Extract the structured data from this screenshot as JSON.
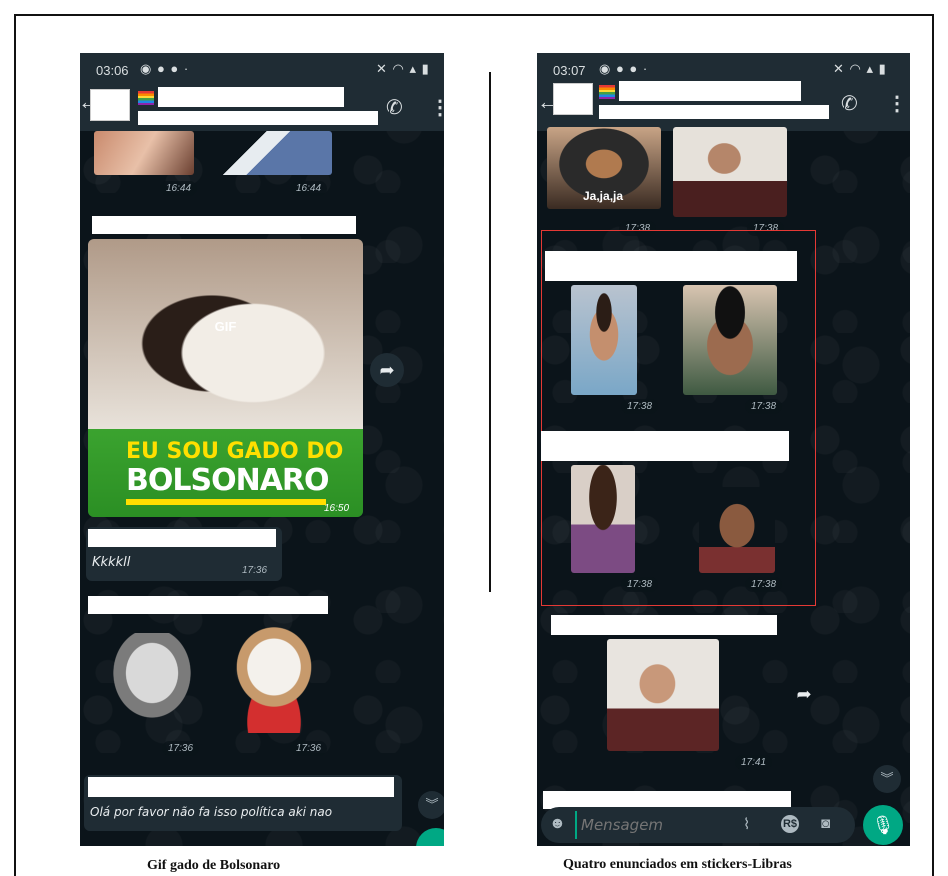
{
  "left_phone": {
    "status_time": "03:06",
    "timestamps_top": [
      "16:44",
      "16:44"
    ],
    "gif_label": "GIF",
    "banner_line1": "EU SOU GADO DO",
    "banner_line2": "BOLSONARO",
    "gif_time": "16:50",
    "message_1": "Kkkkll",
    "message_1_time": "17:36",
    "sticker_times": [
      "17:36",
      "17:36"
    ],
    "message_2": "Olá por favor não fa isso política aki nao"
  },
  "right_phone": {
    "status_time": "03:07",
    "top_sticker_caption": "Ja,ja,ja",
    "top_times": [
      "17:38",
      "17:38"
    ],
    "libras_times": [
      "17:38",
      "17:38",
      "17:38",
      "17:38"
    ],
    "last_time": "17:41",
    "input_placeholder": "Mensagem"
  },
  "captions": {
    "left": "Gif gado de Bolsonaro",
    "right": "Quatro enunciados em stickers-Libras"
  },
  "icons": {
    "back": "back-arrow-icon",
    "call": "add-call-icon",
    "menu": "menu-icon",
    "forward": "forward-icon",
    "emoji": "emoji-icon",
    "attach": "paperclip-icon",
    "payment": "rs-payment-icon",
    "camera": "camera-icon",
    "mic": "microphone-icon"
  },
  "colors": {
    "chat_bg": "#0b141a",
    "bar_bg": "#1f2c34",
    "accent": "#00a884",
    "highlight_box": "#e53935"
  }
}
